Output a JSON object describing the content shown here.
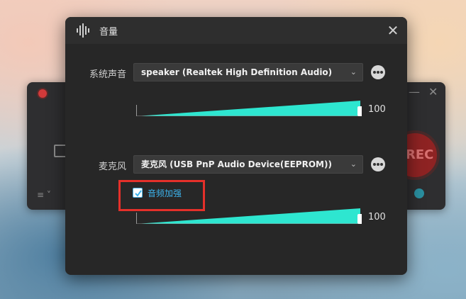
{
  "background_window": {
    "list_icon": "≡ ˅",
    "rec_label": "REC"
  },
  "dialog": {
    "title": "音量",
    "close_glyph": "✕"
  },
  "system_audio": {
    "label": "系统声音",
    "device": "speaker (Realtek High Definition Audio)",
    "volume": 100
  },
  "microphone": {
    "label": "麦克风",
    "device": "麦克风 (USB PnP Audio Device(EEPROM))",
    "volume": 100,
    "enhance_label": "音频加强",
    "enhance_checked": true
  },
  "colors": {
    "slider_fill": "#2ee6d0",
    "highlight": "#e5302a",
    "checkbox_accent": "#3db4ee"
  }
}
